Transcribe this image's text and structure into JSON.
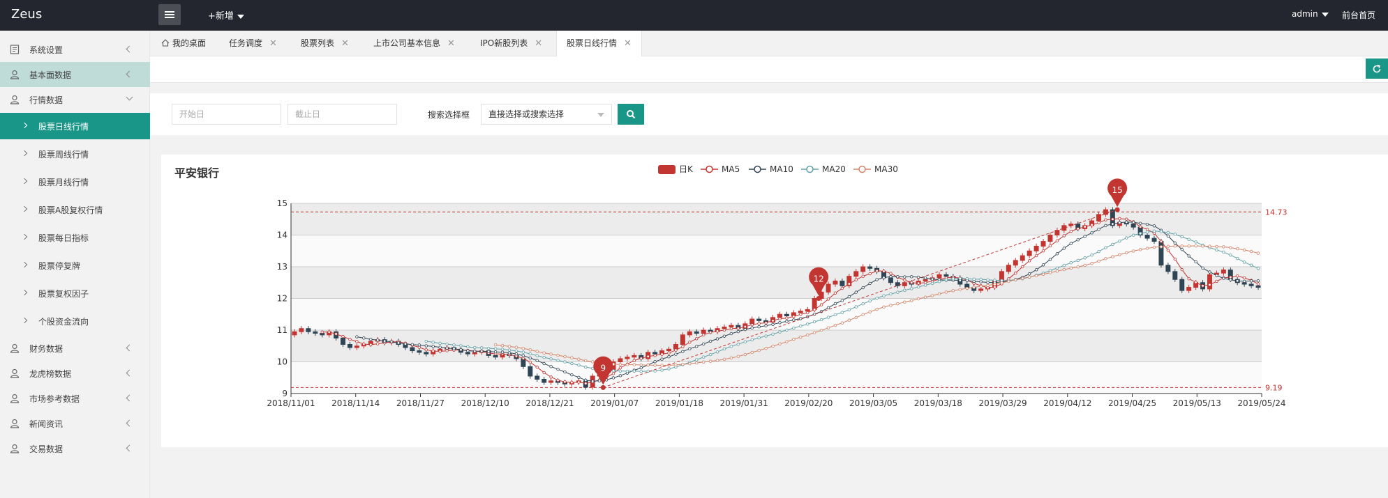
{
  "app": {
    "logo": "Zeus",
    "new_label": "+新增",
    "user": "admin",
    "front_link": "前台首页"
  },
  "sidebar": {
    "items": [
      {
        "label": "系统设置",
        "icon": "settings-doc-icon",
        "expanded": false
      },
      {
        "label": "基本面数据",
        "icon": "user-icon",
        "expanded": false
      },
      {
        "label": "行情数据",
        "icon": "user-icon",
        "expanded": true
      }
    ],
    "sub_items": [
      {
        "label": "股票日线行情",
        "active": true
      },
      {
        "label": "股票周线行情"
      },
      {
        "label": "股票月线行情"
      },
      {
        "label": "股票A股复权行情"
      },
      {
        "label": "股票每日指标"
      },
      {
        "label": "股票停复牌"
      },
      {
        "label": "股票复权因子"
      },
      {
        "label": "个股资金流向"
      }
    ],
    "items_after": [
      {
        "label": "财务数据",
        "icon": "user-icon"
      },
      {
        "label": "龙虎榜数据",
        "icon": "user-icon"
      },
      {
        "label": "市场参考数据",
        "icon": "user-icon"
      },
      {
        "label": "新闻资讯",
        "icon": "user-icon"
      },
      {
        "label": "交易数据",
        "icon": "user-icon"
      }
    ]
  },
  "tabs": [
    {
      "label": "我的桌面",
      "closable": false,
      "icon": "home-icon"
    },
    {
      "label": "任务调度",
      "closable": true
    },
    {
      "label": "股票列表",
      "closable": true
    },
    {
      "label": "上市公司基本信息",
      "closable": true
    },
    {
      "label": "IPO新股列表",
      "closable": true
    },
    {
      "label": "股票日线行情",
      "closable": true,
      "active": true
    }
  ],
  "search": {
    "start_placeholder": "开始日",
    "end_placeholder": "截止日",
    "select_label": "搜索选择框",
    "select_value": "直接选择或搜索选择"
  },
  "colors": {
    "accent": "#1a9688",
    "up": "#c23531",
    "down": "#2f4554",
    "ma5": "#c23531",
    "ma10": "#2f4554",
    "ma20": "#61a0a8",
    "ma30": "#d48265"
  },
  "chart_data": {
    "type": "candlestick",
    "title": "平安银行",
    "legend": [
      "日K",
      "MA5",
      "MA10",
      "MA20",
      "MA30"
    ],
    "legend_placement": "top-center",
    "ylim": [
      9,
      15
    ],
    "y_ticks": [
      9,
      10,
      11,
      12,
      13,
      14,
      15
    ],
    "x_tick_labels": [
      "2018/11/01",
      "2018/11/14",
      "2018/11/27",
      "2018/12/10",
      "2018/12/21",
      "2019/01/07",
      "2019/01/18",
      "2019/01/31",
      "2019/02/20",
      "2019/03/05",
      "2019/03/18",
      "2019/03/29",
      "2019/04/12",
      "2019/04/25",
      "2019/05/13",
      "2019/05/24"
    ],
    "mark_lines": [
      14.73,
      9.19
    ],
    "mark_points": [
      {
        "label": "9",
        "value": 9.19,
        "date": "2019/01/04"
      },
      {
        "label": "12",
        "value": 12.0,
        "date": "2019/02/22"
      },
      {
        "label": "15",
        "value": 14.8,
        "date": "2019/04/22"
      }
    ],
    "trend_line": {
      "from": {
        "date": "2019/01/04",
        "value": 9.19
      },
      "to": {
        "date": "2019/04/22",
        "value": 14.8
      }
    },
    "close": [
      10.95,
      11.05,
      10.95,
      10.9,
      10.85,
      10.95,
      10.75,
      10.55,
      10.45,
      10.5,
      10.55,
      10.65,
      10.7,
      10.6,
      10.65,
      10.55,
      10.45,
      10.35,
      10.3,
      10.25,
      10.35,
      10.4,
      10.45,
      10.4,
      10.3,
      10.25,
      10.3,
      10.35,
      10.2,
      10.15,
      10.25,
      10.2,
      10.1,
      9.85,
      9.55,
      9.45,
      9.35,
      9.4,
      9.35,
      9.3,
      9.35,
      9.4,
      9.2,
      9.55,
      9.65,
      9.75,
      10.0,
      10.1,
      10.15,
      10.2,
      10.1,
      10.3,
      10.25,
      10.35,
      10.4,
      10.55,
      10.85,
      10.95,
      10.9,
      11.0,
      10.95,
      11.05,
      11.1,
      11.15,
      11.05,
      11.2,
      11.35,
      11.3,
      11.25,
      11.4,
      11.5,
      11.45,
      11.55,
      11.6,
      11.65,
      12.0,
      12.2,
      12.45,
      12.55,
      12.4,
      12.7,
      12.85,
      13.0,
      12.95,
      12.85,
      12.65,
      12.5,
      12.4,
      12.5,
      12.45,
      12.55,
      12.6,
      12.65,
      12.75,
      12.7,
      12.65,
      12.45,
      12.35,
      12.25,
      12.3,
      12.35,
      12.55,
      12.85,
      13.05,
      13.2,
      13.35,
      13.5,
      13.65,
      13.8,
      14.0,
      14.15,
      14.3,
      14.35,
      14.2,
      14.3,
      14.45,
      14.65,
      14.8,
      14.3,
      14.4,
      14.35,
      14.25,
      14.0,
      13.9,
      13.8,
      13.05,
      12.85,
      12.6,
      12.25,
      12.35,
      12.5,
      12.3,
      12.75,
      12.8,
      12.9,
      12.6,
      12.5,
      12.45,
      12.4,
      12.35
    ]
  }
}
